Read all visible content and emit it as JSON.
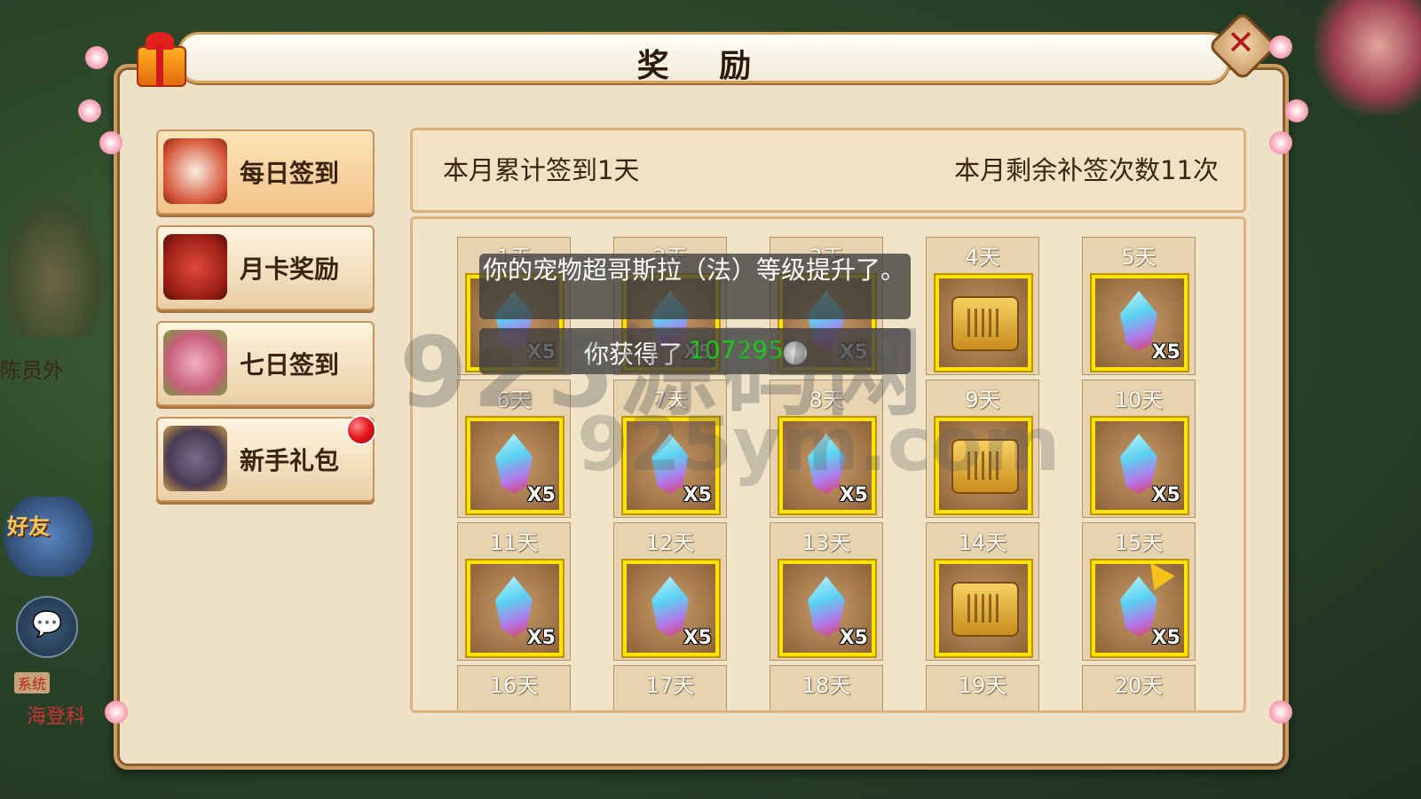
{
  "background": {
    "npc_name": "陈员外",
    "friend_label": "好友",
    "system_tag": "系统",
    "system_text": "海登科"
  },
  "dialog": {
    "title": "奖 励",
    "close_icon": "close-icon",
    "info_left": "本月累计签到1天",
    "info_right": "本月剩余补签次数11次"
  },
  "tabs": [
    {
      "label": "每日签到",
      "icon": "letter-seal-icon",
      "active": true
    },
    {
      "label": "月卡奖励",
      "icon": "pot-icon",
      "active": false
    },
    {
      "label": "七日签到",
      "icon": "scroll-roll-icon",
      "active": false
    },
    {
      "label": "新手礼包",
      "icon": "bag-icon",
      "active": false,
      "badge": true
    }
  ],
  "days": [
    {
      "label": "1天",
      "item": "crystal",
      "qty": "X5"
    },
    {
      "label": "2天",
      "item": "crystal",
      "qty": "X5"
    },
    {
      "label": "3天",
      "item": "crystal",
      "qty": "X5"
    },
    {
      "label": "4天",
      "item": "scroll",
      "qty": ""
    },
    {
      "label": "5天",
      "item": "crystal",
      "qty": "X5"
    },
    {
      "label": "6天",
      "item": "crystal",
      "qty": "X5"
    },
    {
      "label": "7天",
      "item": "crystal",
      "qty": "X5"
    },
    {
      "label": "8天",
      "item": "crystal",
      "qty": "X5"
    },
    {
      "label": "9天",
      "item": "scroll",
      "qty": ""
    },
    {
      "label": "10天",
      "item": "crystal",
      "qty": "X5"
    },
    {
      "label": "11天",
      "item": "crystal",
      "qty": "X5"
    },
    {
      "label": "12天",
      "item": "crystal",
      "qty": "X5"
    },
    {
      "label": "13天",
      "item": "crystal",
      "qty": "X5"
    },
    {
      "label": "14天",
      "item": "scroll",
      "qty": ""
    },
    {
      "label": "15天",
      "item": "crystal",
      "qty": "X5"
    },
    {
      "label": "16天",
      "item": "",
      "qty": ""
    },
    {
      "label": "17天",
      "item": "",
      "qty": ""
    },
    {
      "label": "18天",
      "item": "",
      "qty": ""
    },
    {
      "label": "19天",
      "item": "",
      "qty": ""
    },
    {
      "label": "20天",
      "item": "",
      "qty": ""
    }
  ],
  "notifications": {
    "pet_level": "你的宠物超哥斯拉（法）等级提升了。",
    "gain_prefix": "你获得了",
    "gain_amount": "107295",
    "gain_icon": "silver-coin-icon"
  },
  "watermark": {
    "line1": "925源码网",
    "line2": "925ym.com"
  }
}
